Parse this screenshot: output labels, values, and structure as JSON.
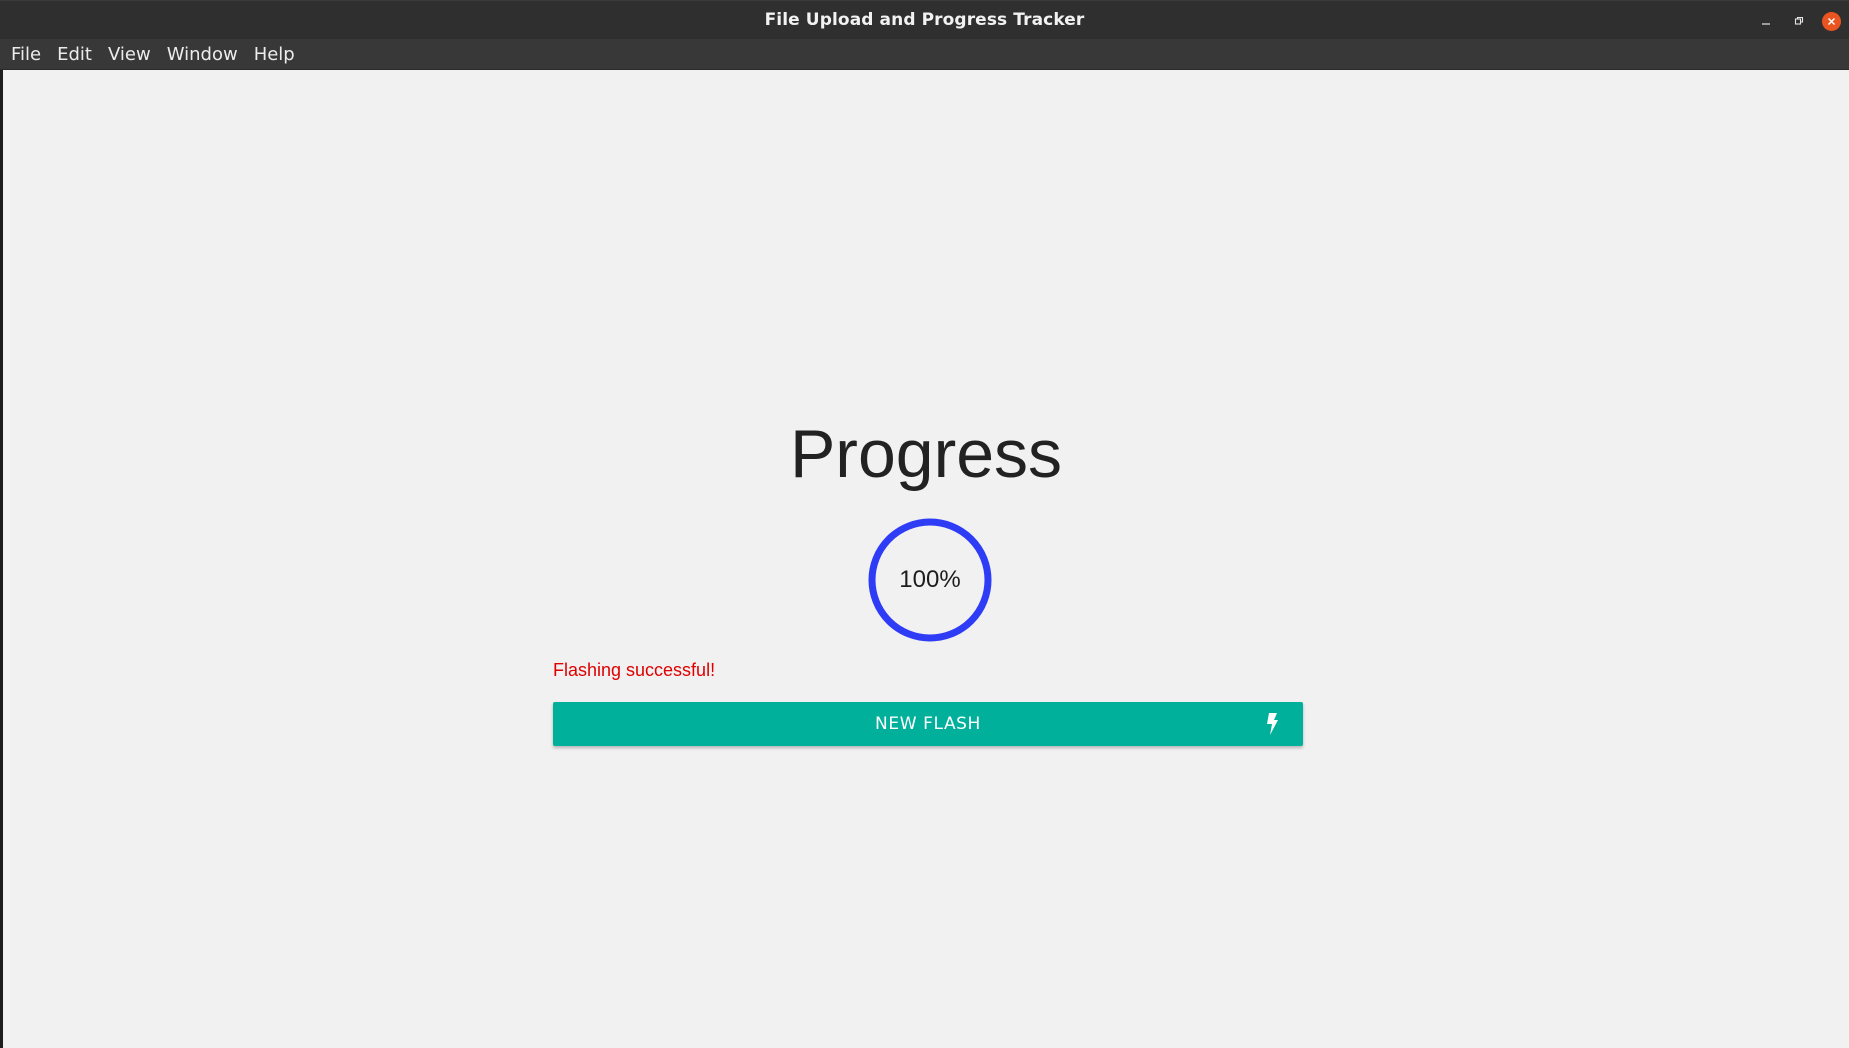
{
  "window": {
    "title": "File Upload and Progress Tracker",
    "controls": [
      "minimize-icon",
      "restore-icon",
      "close-icon"
    ],
    "close_color": "#e95420"
  },
  "menu": {
    "items": [
      "File",
      "Edit",
      "View",
      "Window",
      "Help"
    ]
  },
  "main": {
    "heading": "Progress",
    "progress": {
      "value": 100,
      "label": "100%",
      "ring_color": "#2e3cf5"
    },
    "status": {
      "text": "Flashing successful!",
      "color": "#e00000"
    },
    "action_button": {
      "label": "NEW FLASH",
      "icon": "lightning-bolt-icon",
      "color": "#00b09b"
    }
  }
}
